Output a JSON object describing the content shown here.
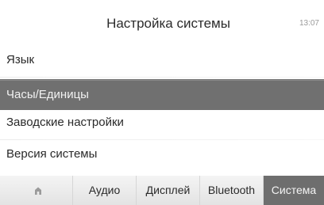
{
  "header": {
    "title": "Настройка системы",
    "clock": "13:07"
  },
  "menu": {
    "items": [
      {
        "label": "Язык"
      },
      {
        "label": "Часы/Единицы"
      },
      {
        "label": "Заводские настройки"
      },
      {
        "label": "Версия системы"
      }
    ],
    "selected_index": 1
  },
  "tabs": {
    "home_icon": "home-icon",
    "items": [
      {
        "label": "Аудио"
      },
      {
        "label": "Дисплей"
      },
      {
        "label": "Bluetooth"
      },
      {
        "label": "Система"
      }
    ],
    "active": "Система"
  },
  "colors": {
    "selected_bg": "#707070",
    "tab_bg": "#e8e8e8",
    "background": "#ffffff"
  }
}
